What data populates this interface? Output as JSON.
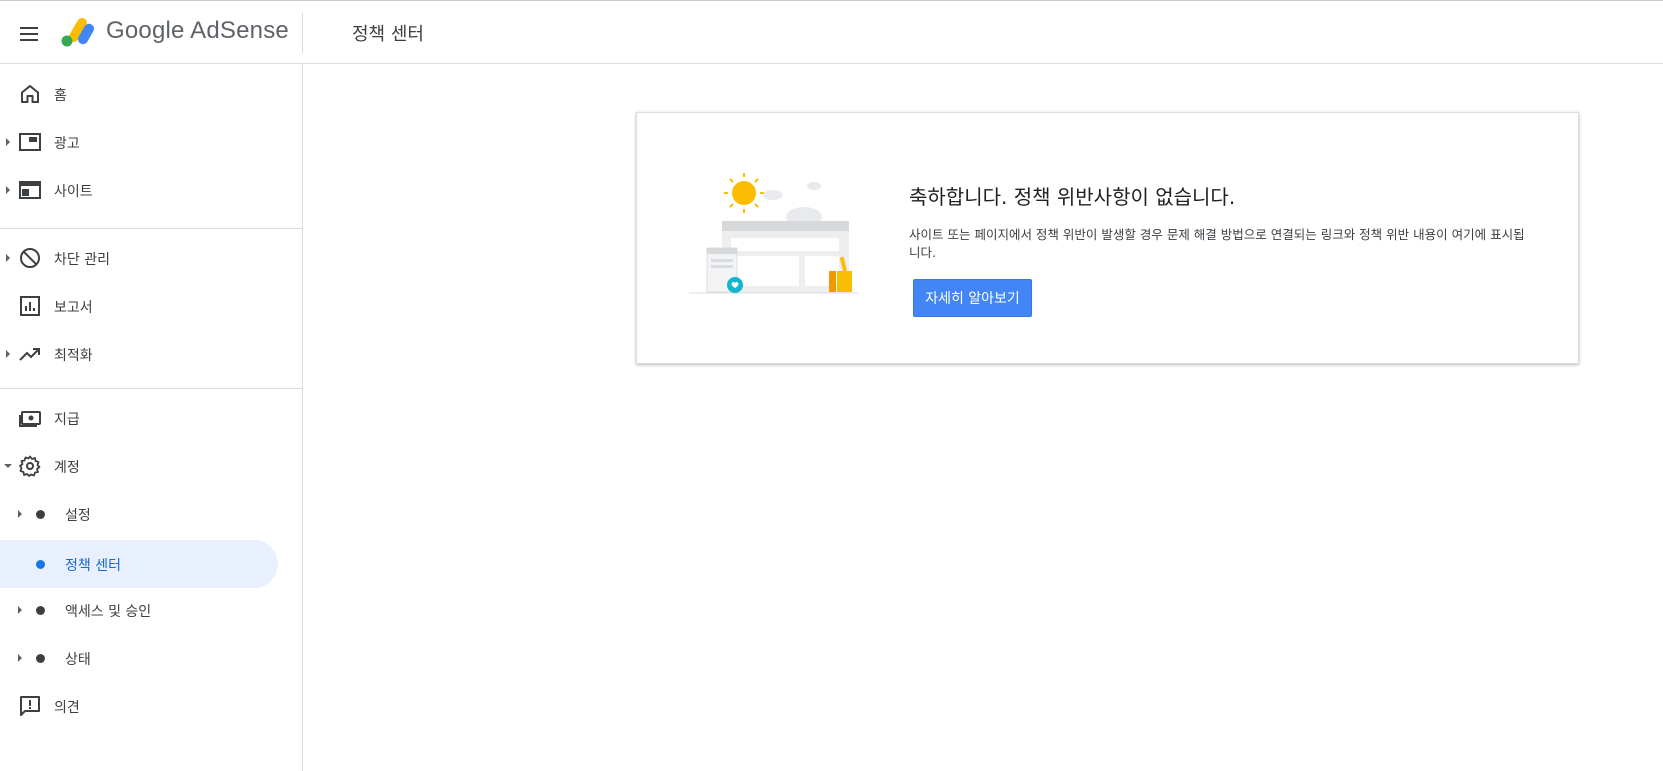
{
  "app": {
    "logo_text": "Google AdSense",
    "page_title": "정책 센터"
  },
  "sidebar": {
    "items": [
      {
        "label": "홈",
        "icon": "home-icon"
      },
      {
        "label": "광고",
        "icon": "ads-icon"
      },
      {
        "label": "사이트",
        "icon": "sites-icon"
      },
      {
        "label": "차단 관리",
        "icon": "block-icon"
      },
      {
        "label": "보고서",
        "icon": "reports-icon"
      },
      {
        "label": "최적화",
        "icon": "trending-up-icon"
      },
      {
        "label": "지급",
        "icon": "payments-icon"
      },
      {
        "label": "계정",
        "icon": "gear-icon"
      },
      {
        "label": "설정"
      },
      {
        "label": "정책 센터"
      },
      {
        "label": "액세스 및 승인"
      },
      {
        "label": "상태"
      },
      {
        "label": "의견",
        "icon": "feedback-icon"
      }
    ]
  },
  "card": {
    "title": "축하합니다. 정책 위반사항이 없습니다.",
    "description": "사이트 또는 페이지에서 정책 위반이 발생할 경우 문제 해결 방법으로 연결되는 링크와 정책 위반 내용이 여기에 표시됩니다.",
    "button_label": "자세히 알아보기"
  },
  "colors": {
    "accent": "#4285f4",
    "active_bg": "#e8f0fe",
    "active_text": "#1967d2"
  }
}
